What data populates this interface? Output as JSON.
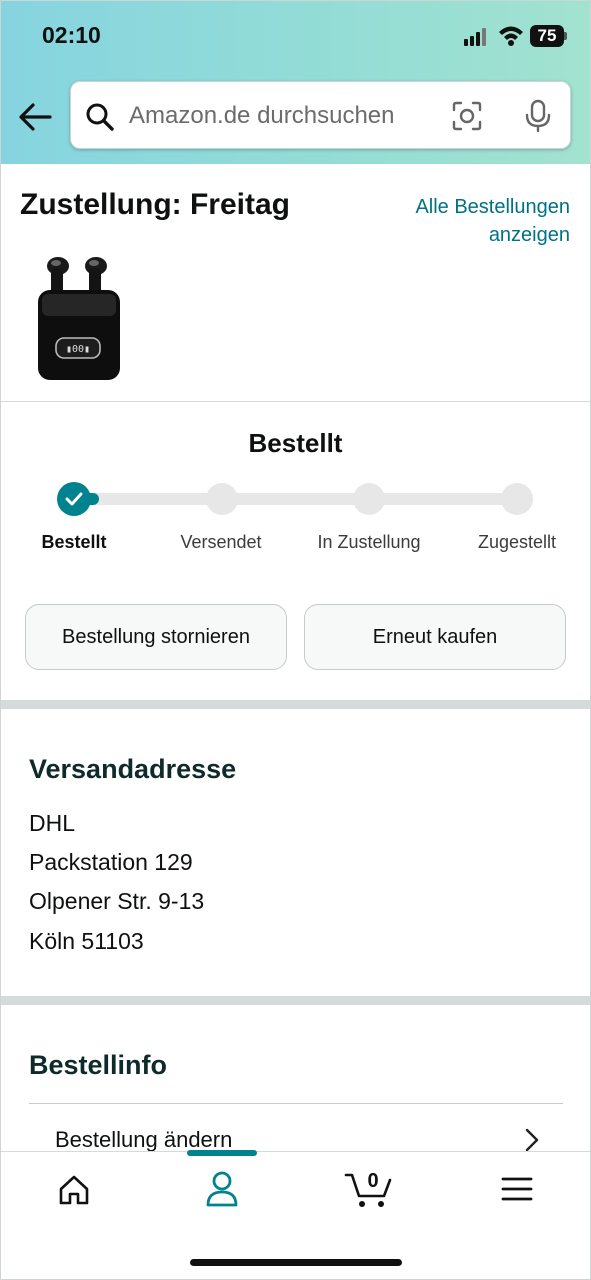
{
  "status_bar": {
    "time": "02:10",
    "battery": "75"
  },
  "search": {
    "placeholder": "Amazon.de durchsuchen"
  },
  "delivery": {
    "title": "Zustellung: Freitag",
    "all_orders_link": "Alle Bestellungen anzeigen"
  },
  "tracker": {
    "heading": "Bestellt",
    "steps": [
      {
        "label": "Bestellt",
        "state": "done"
      },
      {
        "label": "Versendet",
        "state": "pending"
      },
      {
        "label": "In Zustellung",
        "state": "pending"
      },
      {
        "label": "Zugestellt",
        "state": "pending"
      }
    ],
    "accent_color": "#00838f"
  },
  "actions": {
    "cancel_label": "Bestellung stornieren",
    "rebuy_label": "Erneut kaufen"
  },
  "shipping_address": {
    "title": "Versandadresse",
    "lines": [
      "DHL",
      "Packstation 129",
      "Olpener Str. 9-13",
      "Köln 51103"
    ]
  },
  "order_info": {
    "title": "Bestellinfo",
    "rows": [
      {
        "label": "Bestellung ändern"
      }
    ]
  },
  "bottom_nav": {
    "items": [
      {
        "name": "home-icon"
      },
      {
        "name": "account-icon",
        "active": true
      },
      {
        "name": "cart-icon",
        "count": "0"
      },
      {
        "name": "menu-icon"
      }
    ]
  },
  "colors": {
    "link": "#007185",
    "accent": "#00838f"
  }
}
